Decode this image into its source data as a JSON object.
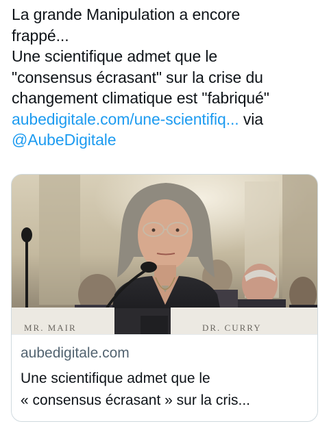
{
  "tweet": {
    "line1": "La grande Manipulation a encore",
    "line2": "frappé...",
    "line3": "Une scientifique admet que le",
    "line4": "\"consensus écrasant\" sur la crise du",
    "line5": "changement climatique est \"fabriqué\"",
    "link": "aubedigitale.com/une-scientifiq...",
    "via": " via",
    "mention": "@AubeDigitale"
  },
  "card": {
    "image": {
      "placard_left": "MR. MAIR",
      "placard_right": "DR. CURRY"
    },
    "domain": "aubedigitale.com",
    "title_line1": "Une scientifique admet que le",
    "title_line2": "« consensus écrasant » sur la cris..."
  },
  "colors": {
    "link": "#1d9bf0",
    "text": "#0f1419",
    "muted": "#536471",
    "border": "#cfd9de"
  }
}
